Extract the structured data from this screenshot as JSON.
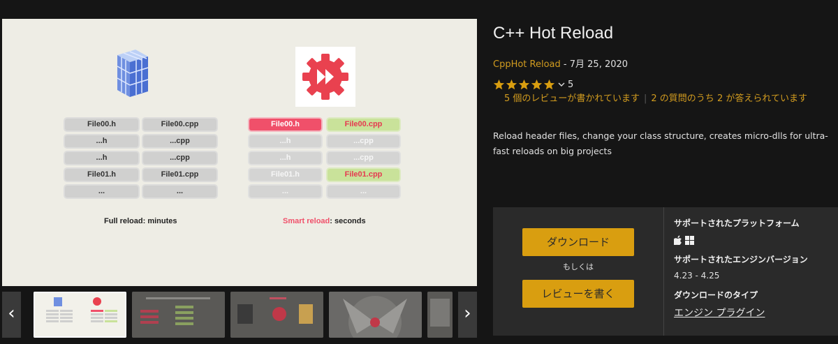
{
  "hero": {
    "left_rows": [
      [
        "File00.h",
        "File00.cpp"
      ],
      [
        "...h",
        "...cpp"
      ],
      [
        "...h",
        "...cpp"
      ],
      [
        "File01.h",
        "File01.cpp"
      ],
      [
        "...",
        "..."
      ]
    ],
    "right_rows": [
      [
        "File00.h",
        "File00.cpp"
      ],
      [
        "...h",
        "...cpp"
      ],
      [
        "...h",
        "...cpp"
      ],
      [
        "File01.h",
        "File01.cpp"
      ],
      [
        "...",
        "..."
      ]
    ],
    "left_caption": "Full reload: minutes",
    "right_caption_highlight": "Smart reload",
    "right_caption_rest": ": seconds"
  },
  "thumbs": {
    "prev_icon": "chevron-left-icon",
    "next_icon": "chevron-right-icon",
    "prev_label": "‹",
    "next_label": "›"
  },
  "product": {
    "title": "C++ Hot Reload",
    "seller": "CppHot Reload",
    "date_sep": " - ",
    "date": "7月 25, 2020",
    "rating_value": "5",
    "stars": 5,
    "reviews_link": "5 個のレビューが書かれています",
    "questions_link": "2 の質問のうち 2 が答えられています",
    "description": "Reload header files, change your class structure, creates micro-dlls for ultra-fast reloads on big projects"
  },
  "purchase": {
    "download_label": "ダウンロード",
    "or_label": "もしくは",
    "review_label": "レビューを書く"
  },
  "info": {
    "platforms_heading": "サポートされたプラットフォーム",
    "platform_icons": [
      "apple-icon",
      "windows-icon"
    ],
    "engine_heading": "サポートされたエンジンバージョン",
    "engine_versions": "4.23 - 4.25",
    "type_heading": "ダウンロードのタイプ",
    "type_value": "エンジン プラグイン"
  },
  "colors": {
    "accent": "#d99e10",
    "seller": "#d29c1f",
    "hero_bg": "#eeede5",
    "red": "#f0506a",
    "green": "#c9e29a"
  }
}
